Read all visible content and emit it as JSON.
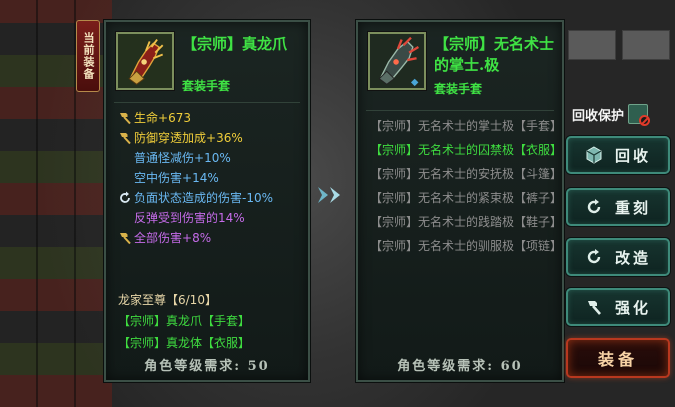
{
  "equipped_tag": "当前装备",
  "left_panel": {
    "name_bracket": "【宗师】",
    "name_main": "真龙爪",
    "type": "套装手套",
    "stats": [
      {
        "icon": "hammer-icon",
        "label": "生命",
        "value": "+673",
        "color": "yellow",
        "indent": false
      },
      {
        "icon": "hammer-icon",
        "label": "防御穿透加成",
        "value": "+36%",
        "color": "yellow",
        "indent": false
      },
      {
        "icon": "",
        "label": "普通怪减伤",
        "value": "+10%",
        "color": "blue",
        "indent": true
      },
      {
        "icon": "",
        "label": "空中伤害",
        "value": "+14%",
        "color": "blue",
        "indent": true
      },
      {
        "icon": "refresh-icon",
        "label": "负面状态造成的伤害",
        "value": "-10%",
        "color": "blue",
        "indent": false
      },
      {
        "icon": "",
        "label": "反弹受到伤害的",
        "value": "14%",
        "color": "purple",
        "indent": true
      },
      {
        "icon": "hammer-icon",
        "label": "全部伤害",
        "value": "+8%",
        "color": "purple",
        "indent": false
      }
    ],
    "set_title": "龙家至尊【6/10】",
    "set_items": [
      "【宗师】真龙爪【手套】",
      "【宗师】真龙体【衣服】"
    ],
    "requirement_label": "角色等级需求:",
    "requirement_value": "50"
  },
  "right_panel": {
    "name_bracket": "【宗师】",
    "name_main": "无名术士的掌士.极",
    "type": "套装手套",
    "set_entries": [
      {
        "text": "【宗师】无名术士的掌士极【手套】",
        "active": false
      },
      {
        "text": "【宗师】无名术士的囚禁极【衣服】",
        "active": true
      },
      {
        "text": "【宗师】无名术士的安抚极【斗篷】",
        "active": false
      },
      {
        "text": "【宗师】无名术士的紧束极【裤子】",
        "active": false
      },
      {
        "text": "【宗师】无名术士的践踏极【鞋子】",
        "active": false
      },
      {
        "text": "【宗师】无名术士的驯服极【项链】",
        "active": false
      }
    ],
    "requirement_label": "角色等级需求:",
    "requirement_value": "60"
  },
  "recycle_protect_label": "回收保护",
  "buttons": {
    "recycle": "回收",
    "reforge": "重刻",
    "remake": "改造",
    "enhance": "强化",
    "equip": "装备"
  },
  "colors": {
    "name_green": "#3fe244",
    "stat_yellow": "#f0ce3a",
    "stat_blue": "#6ab8f2",
    "stat_purple": "#c56be9",
    "set_green": "#3fdd40",
    "button_border": "#3e8a7a",
    "equip_border": "#b8381f"
  }
}
